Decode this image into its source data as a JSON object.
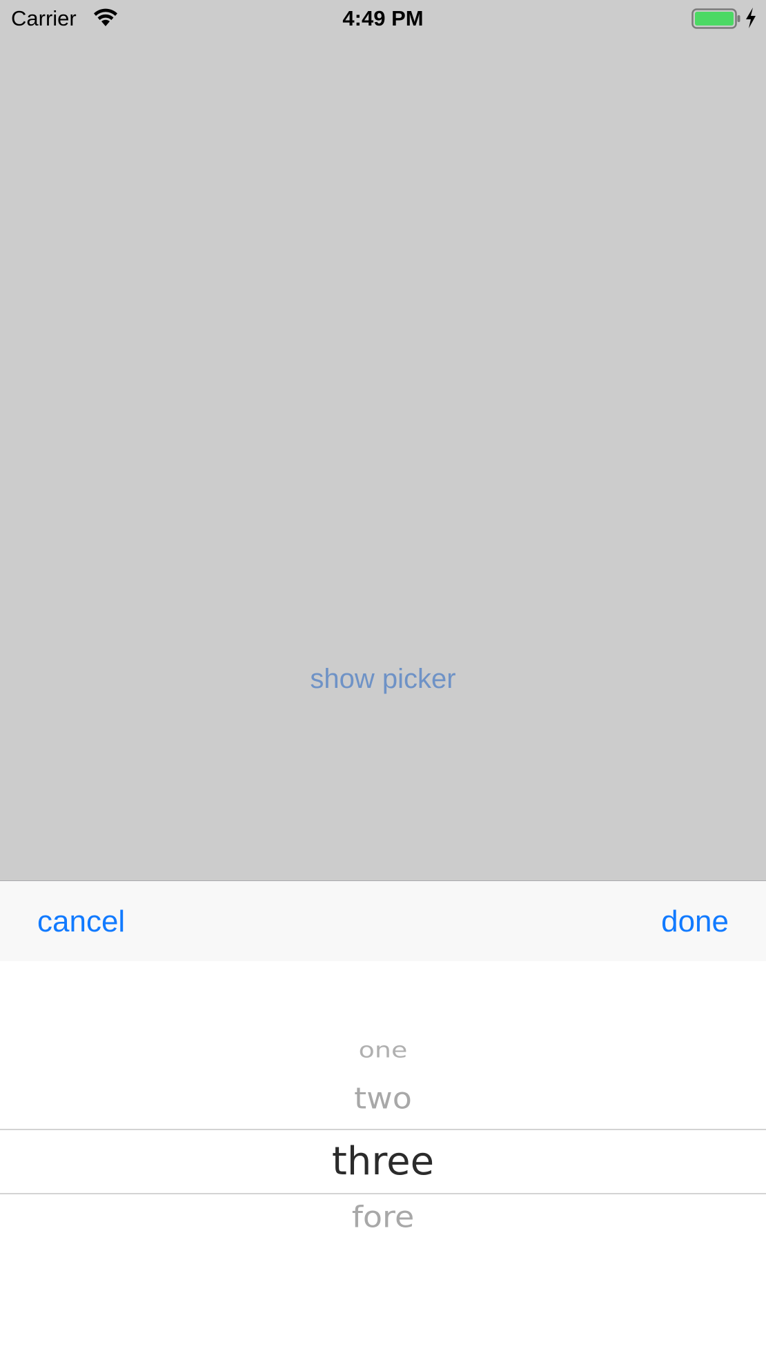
{
  "status_bar": {
    "carrier": "Carrier",
    "time": "4:49 PM",
    "battery_color": "#4cd964",
    "icons": [
      "wifi-icon",
      "battery-icon",
      "charging-icon"
    ]
  },
  "main": {
    "show_picker_label": "show picker",
    "background_color": "#cccccc",
    "link_color": "#6e92c6"
  },
  "toolbar": {
    "cancel_label": "cancel",
    "done_label": "done",
    "accent_color": "#117aff"
  },
  "picker": {
    "rows": [
      "one",
      "two",
      "three",
      "fore"
    ],
    "selected": "three"
  }
}
